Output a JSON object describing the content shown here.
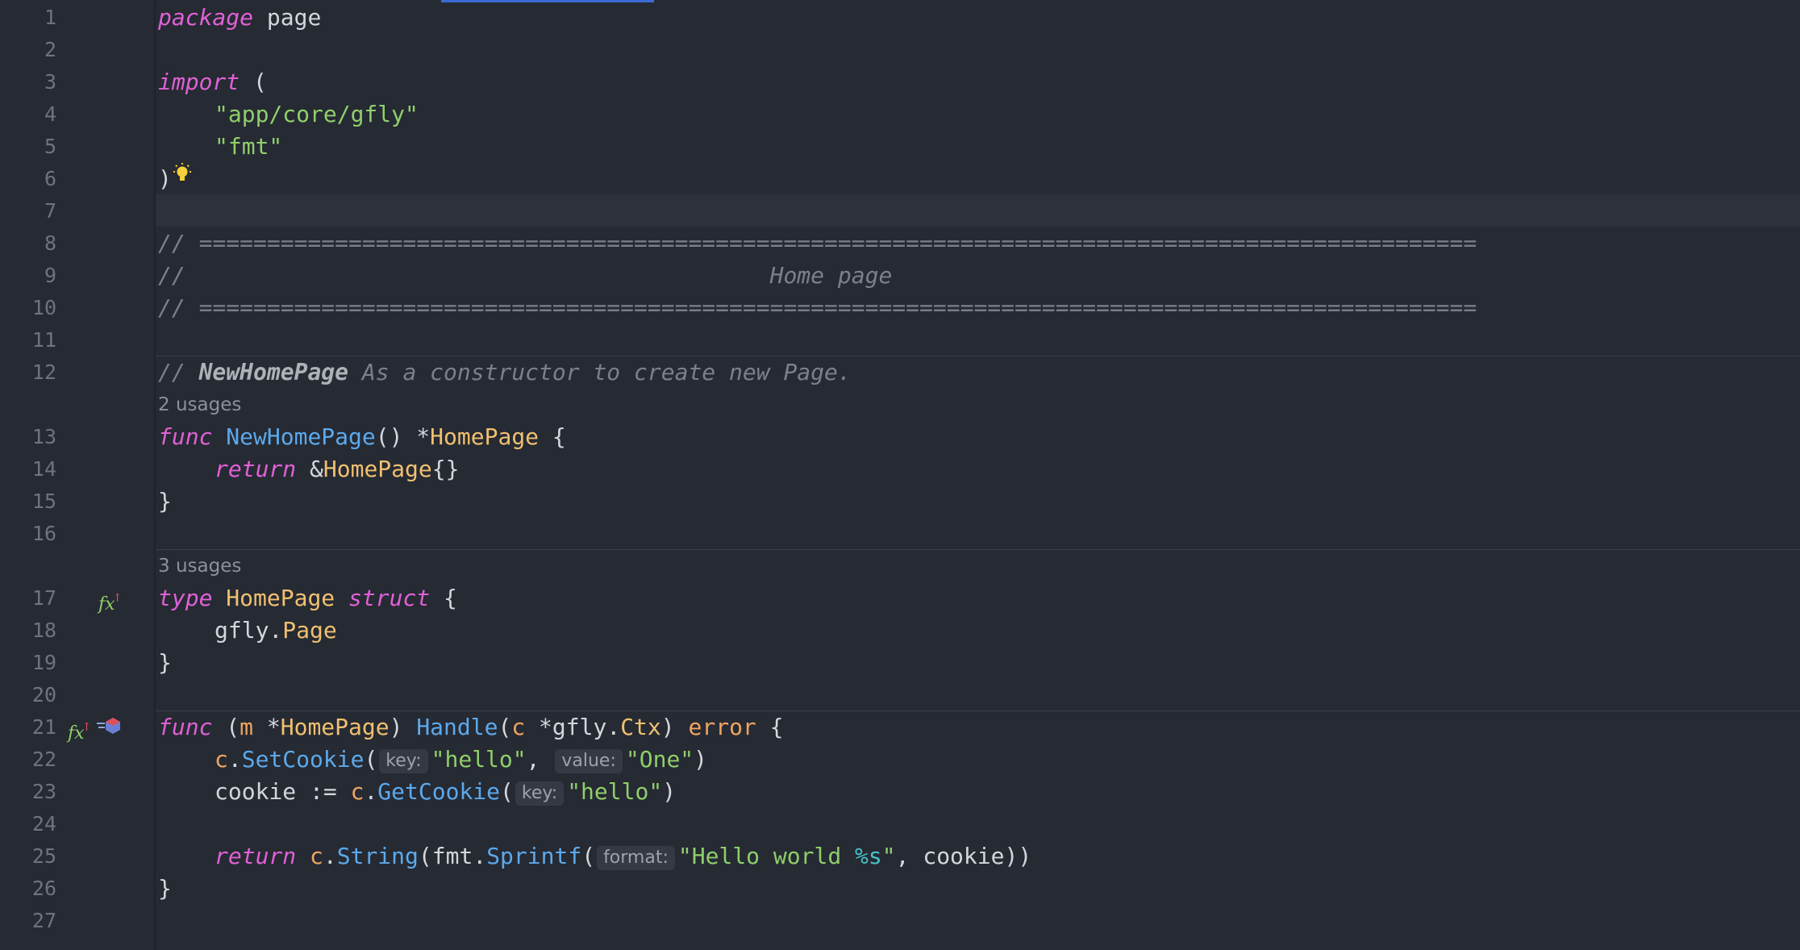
{
  "gutter": {
    "line_numbers": [
      "1",
      "2",
      "3",
      "4",
      "5",
      "6",
      "7",
      "8",
      "9",
      "10",
      "11",
      "12",
      "13",
      "14",
      "15",
      "16",
      "17",
      "18",
      "19",
      "20",
      "21",
      "22",
      "23",
      "24",
      "25",
      "26",
      "27"
    ]
  },
  "annotations": {
    "usages_13": "2 usages",
    "usages_17": "3 usages"
  },
  "gutter_icons": {
    "line17": "implemented-override-icon",
    "line21_a": "implemented-override-icon",
    "line21_b": "go-to-interface-icon",
    "fx_symbol": "fx",
    "fx_arrow": "↑"
  },
  "code": {
    "l1": {
      "kw": "package",
      "rest": " page"
    },
    "l3": {
      "kw": "import",
      "rest": " ("
    },
    "l4": "\"app/core/gfly\"",
    "l5": "\"fmt\"",
    "l6": ")",
    "l8": "// ==============================================================================================",
    "l9": "//                                           Home page",
    "l10": "// ==============================================================================================",
    "l12": {
      "prefix": "// ",
      "name": "NewHomePage",
      "rest": " As a constructor to create new Page."
    },
    "l13": {
      "kw": "func",
      "fn": "NewHomePage",
      "p1": "() *",
      "ty": "HomePage",
      "p2": " {"
    },
    "l14": {
      "kw": "return",
      "p1": " &",
      "ty": "HomePage",
      "p2": "{}"
    },
    "l15": "}",
    "l17": {
      "kw1": "type",
      "ty": "HomePage",
      "kw2": "struct",
      "p2": " {"
    },
    "l18": {
      "pkg": "gfly.",
      "ty": "Page"
    },
    "l19": "}",
    "l21": {
      "kw": "func",
      "p1": " (",
      "param": "m",
      "p2": " *",
      "ty": "HomePage",
      "p3": ") ",
      "fn": "Handle",
      "p4": "(",
      "param2": "c",
      "p5": " *gfly.",
      "ty2": "Ctx",
      "p6": ") ",
      "ret": "error",
      "p7": " {"
    },
    "l22": {
      "recv": "c",
      "dot": ".",
      "fn": "SetCookie",
      "open": "(",
      "hint1": "key:",
      "s1": "\"hello\"",
      "comma": ", ",
      "hint2": "value:",
      "s2": "\"One\"",
      "close": ")"
    },
    "l23": {
      "var": "cookie := ",
      "recv": "c",
      "dot": ".",
      "fn": "GetCookie",
      "open": "(",
      "hint1": "key:",
      "s1": "\"hello\"",
      "close": ")"
    },
    "l25": {
      "kw": "return",
      "sp": " ",
      "recv": "c",
      "dot": ".",
      "fn": "String",
      "p1": "(fmt.",
      "fn2": "Sprintf",
      "open": "(",
      "hint1": "format:",
      "s1": "\"Hello world ",
      "fmtv": "%s",
      "s2": "\"",
      "p2": ", cookie))"
    },
    "l26": "}"
  }
}
